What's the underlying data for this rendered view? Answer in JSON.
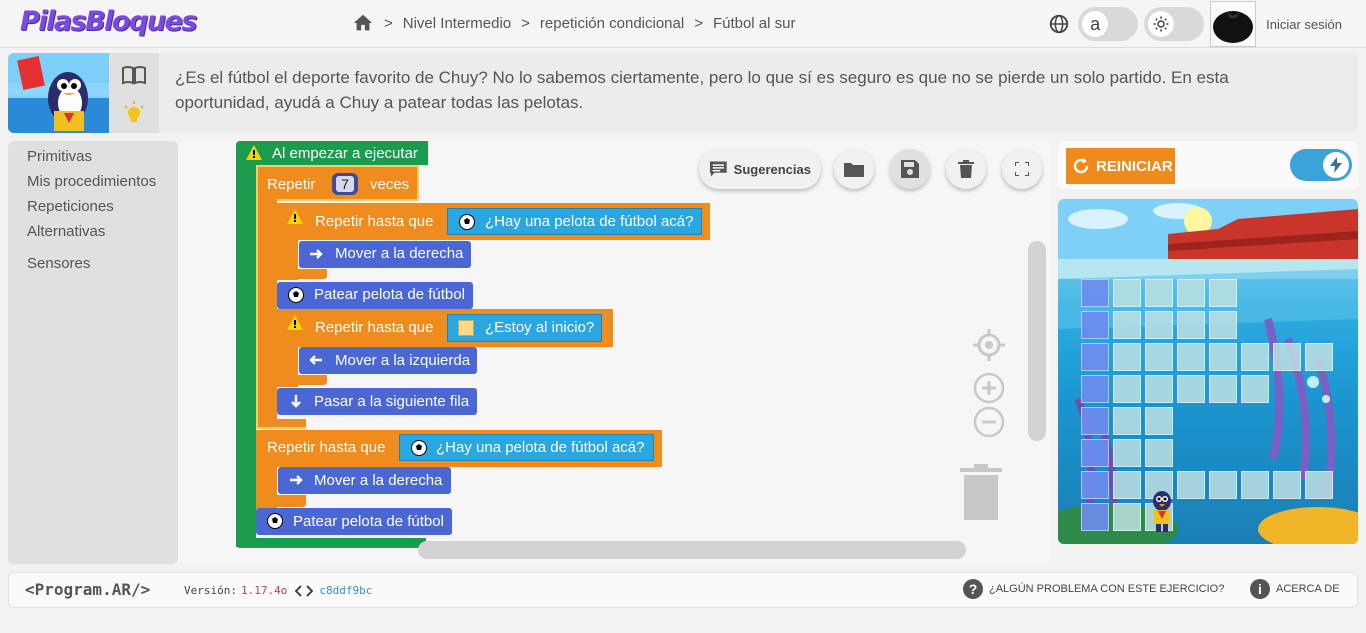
{
  "app": {
    "logo": "PilasBloques"
  },
  "breadcrumb": {
    "items": [
      "Nivel Intermedio",
      "repetición condicional",
      "Fútbol al sur"
    ],
    "separator": ">"
  },
  "header": {
    "login_label": "Iniciar sesión",
    "font_toggle_label": "a"
  },
  "description": {
    "text": "¿Es el fútbol el deporte favorito de Chuy? No lo sabemos ciertamente, pero lo que sí es seguro es que no se pierde un solo partido. En esta oportunidad, ayudá a Chuy a patear todas las pelotas."
  },
  "sidebar": {
    "categories": [
      {
        "label": "Primitivas"
      },
      {
        "label": "Mis procedimientos"
      },
      {
        "label": "Repeticiones"
      },
      {
        "label": "Alternativas"
      },
      {
        "label": "Sensores"
      }
    ]
  },
  "toolbar": {
    "suggestions_label": "Sugerencias"
  },
  "program": {
    "start_block": "Al empezar a ejecutar",
    "repeat_label": "Repetir",
    "repeat_times_value": "7",
    "repeat_suffix": "veces",
    "repeat_until_label": "Repetir hasta que",
    "sensor_ball": "¿Hay una pelota de fútbol acá?",
    "sensor_start": "¿Estoy al inicio?",
    "move_right": "Mover a la derecha",
    "move_left": "Mover a la izquierda",
    "kick_ball": "Patear pelota de fútbol",
    "next_row": "Pasar a la siguiente fila"
  },
  "scene": {
    "reset_label": "REINICIAR"
  },
  "footer": {
    "brand": "<Program.AR/>",
    "version_label": "Versión:",
    "version": "1.17.4o",
    "commit": "c8ddf9bc",
    "problem_label": "¿ALGÚN PROBLEMA CON ESTE EJERCICIO?",
    "about_label": "ACERCA DE"
  },
  "colors": {
    "accent_purple": "#7b4be0",
    "start_green": "#1a9b4d",
    "control_orange": "#f08c1d",
    "action_blue": "#4a67d3",
    "sensor_cyan": "#2aa6e0"
  }
}
